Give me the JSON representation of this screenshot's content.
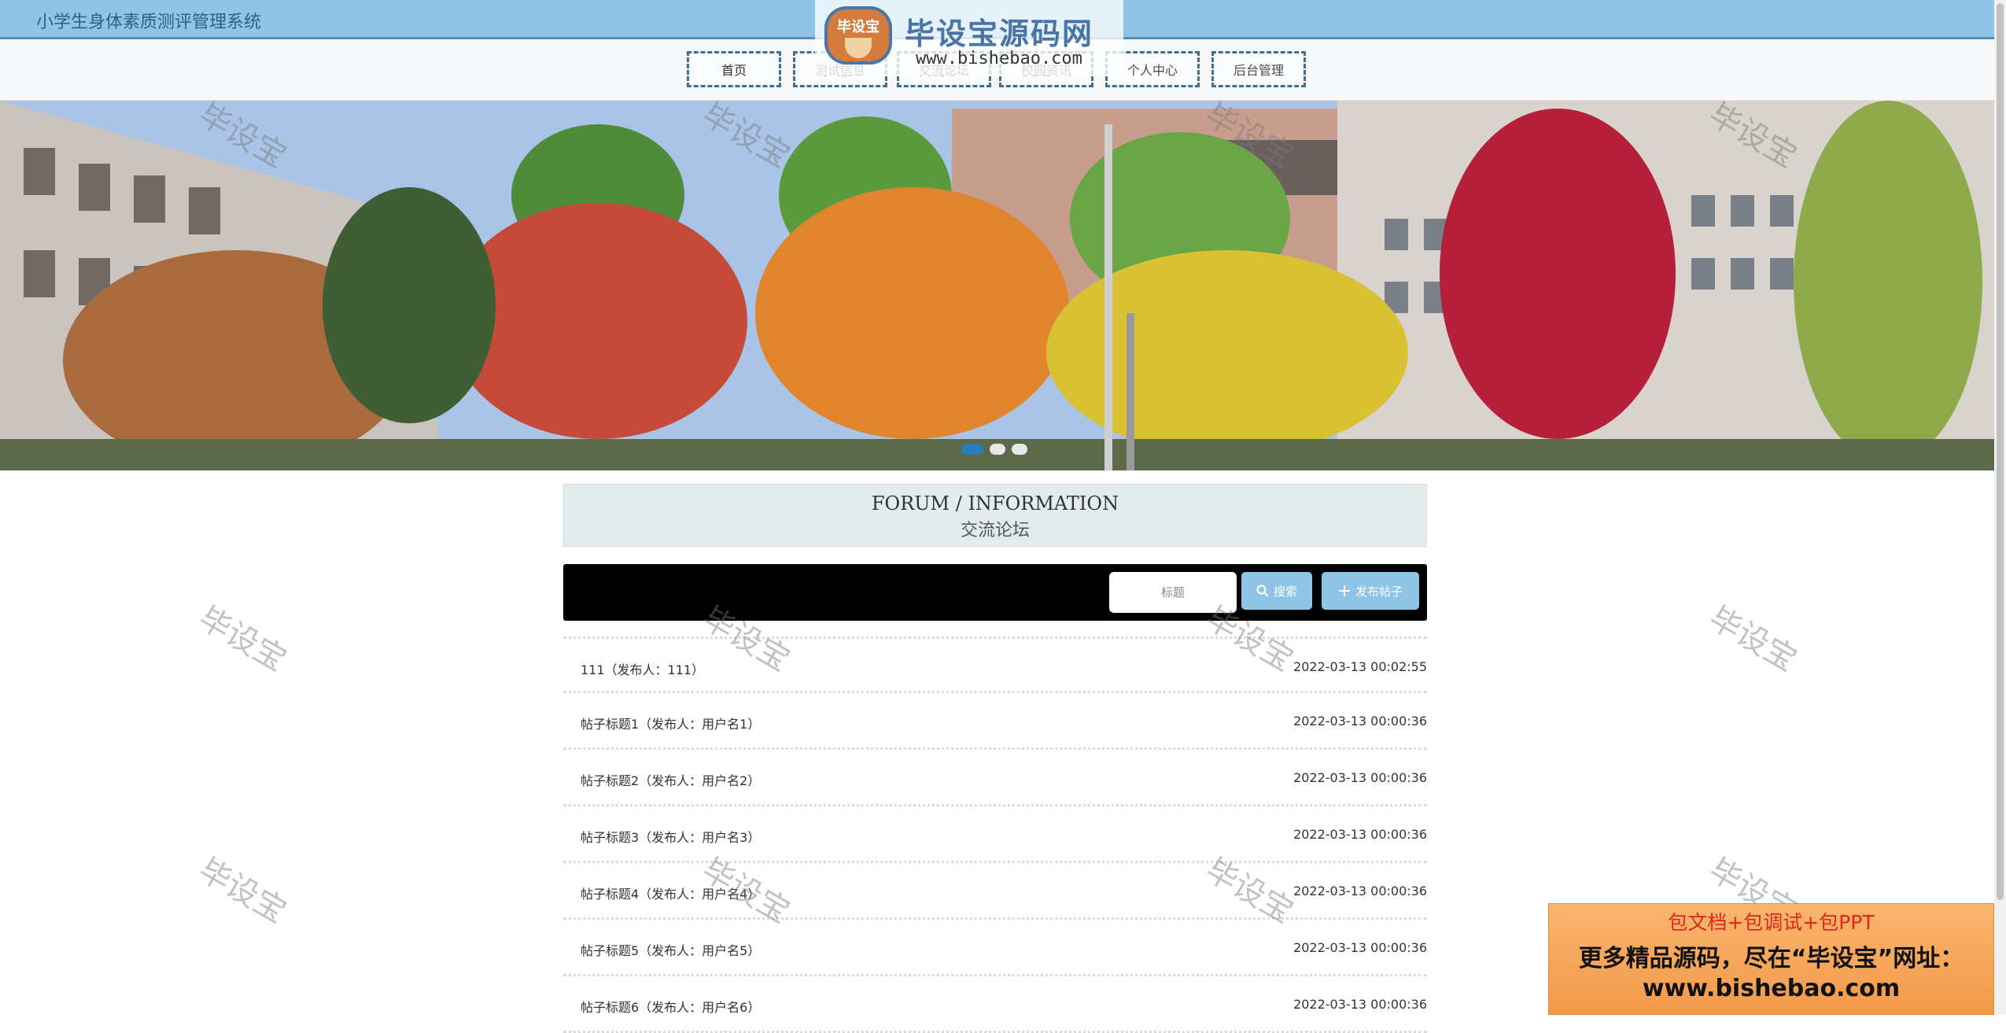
{
  "header": {
    "site_title": "小学生身体素质测评管理系统"
  },
  "nav": {
    "items": [
      {
        "label": "首页"
      },
      {
        "label": "测试信息"
      },
      {
        "label": "交流论坛"
      },
      {
        "label": "校园资讯"
      },
      {
        "label": "个人中心"
      },
      {
        "label": "后台管理"
      }
    ]
  },
  "watermark": {
    "badge": "毕设宝",
    "name": "毕设宝源码网",
    "url": "www.bishebao.com",
    "text": "毕设宝"
  },
  "section": {
    "title_en": "FORUM / INFORMATION",
    "title_cn": "交流论坛"
  },
  "search": {
    "placeholder": "标题",
    "search_label": "搜索",
    "publish_label": "发布帖子"
  },
  "posts": [
    {
      "title": "111（发布人：111）",
      "time": "2022-03-13 00:02:55"
    },
    {
      "title": "帖子标题1（发布人：用户名1）",
      "time": "2022-03-13 00:00:36"
    },
    {
      "title": "帖子标题2（发布人：用户名2）",
      "time": "2022-03-13 00:00:36"
    },
    {
      "title": "帖子标题3（发布人：用户名3）",
      "time": "2022-03-13 00:00:36"
    },
    {
      "title": "帖子标题4（发布人：用户名4）",
      "time": "2022-03-13 00:00:36"
    },
    {
      "title": "帖子标题5（发布人：用户名5）",
      "time": "2022-03-13 00:00:36"
    },
    {
      "title": "帖子标题6（发布人：用户名6）",
      "time": "2022-03-13 00:00:36"
    }
  ],
  "promo": {
    "line1": "包文档+包调试+包PPT",
    "line2": "更多精品源码，尽在“毕设宝”网址：",
    "line3": "www.bishebao.com"
  },
  "colors": {
    "accent": "#8fc4e6",
    "nav_border": "#3f6f97",
    "carousel_active": "#2a7dc0"
  }
}
